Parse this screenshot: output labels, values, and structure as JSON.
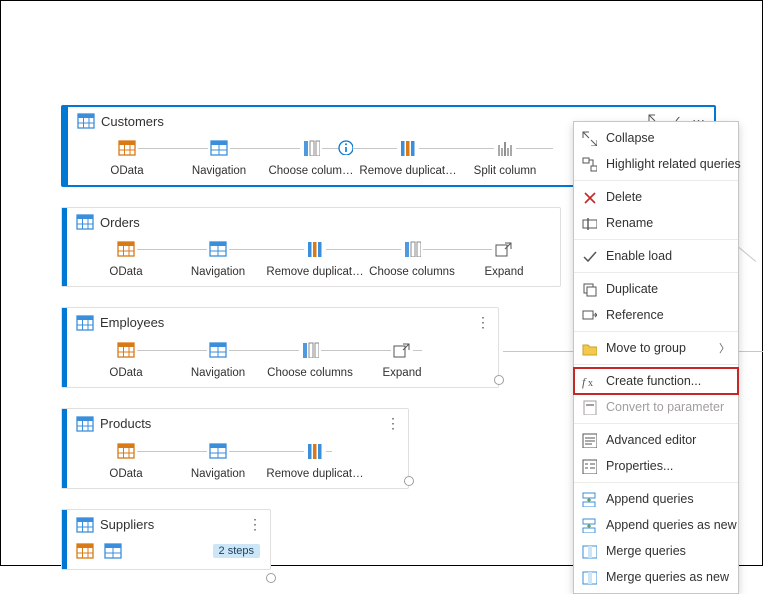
{
  "queries": {
    "customers": {
      "title": "Customers",
      "steps": [
        "OData",
        "Navigation",
        "Choose colum…",
        "Remove duplicat…",
        "Split column"
      ]
    },
    "orders": {
      "title": "Orders",
      "steps": [
        "OData",
        "Navigation",
        "Remove duplicat…",
        "Choose columns",
        "Expand"
      ]
    },
    "employees": {
      "title": "Employees",
      "steps": [
        "OData",
        "Navigation",
        "Choose columns",
        "Expand"
      ]
    },
    "products": {
      "title": "Products",
      "steps": [
        "OData",
        "Navigation",
        "Remove duplicat…"
      ]
    },
    "suppliers": {
      "title": "Suppliers",
      "badge": "2 steps"
    }
  },
  "menu": {
    "collapse": "Collapse",
    "highlight_related": "Highlight related queries",
    "delete": "Delete",
    "rename": "Rename",
    "enable_load": "Enable load",
    "duplicate": "Duplicate",
    "reference": "Reference",
    "move_to_group": "Move to group",
    "create_function": "Create function...",
    "convert_to_parameter": "Convert to parameter",
    "advanced_editor": "Advanced editor",
    "properties": "Properties...",
    "append_queries": "Append queries",
    "append_queries_new": "Append queries as new",
    "merge_queries": "Merge queries",
    "merge_queries_new": "Merge queries as new"
  }
}
